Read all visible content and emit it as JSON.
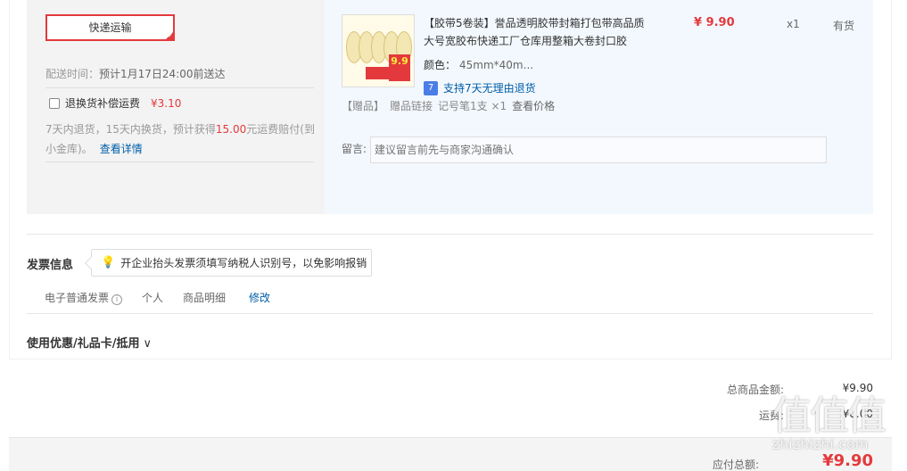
{
  "shipping": {
    "method": "快递运输",
    "delivery_label": "配送时间：",
    "delivery_value": "预计1月17日24:00前送达",
    "freight_insurance_label": "退换货补偿运费",
    "freight_insurance_price": "¥3.10",
    "policy_pre": "7天内退货，15天内换货，预计获得",
    "policy_amount": "15.00",
    "policy_post": "元运费赔付(到小金库)。",
    "policy_link": "查看详情"
  },
  "goods": {
    "title": "【胶带5卷装】誉品透明胶带封箱打包带高品质大号宽胶布快递工厂仓库用整箱大卷封口胶",
    "attr_key": "颜色：",
    "attr_value": "45mm*40m...",
    "return_label": "支持7天无理由退货",
    "gift_tag": "【赠品】",
    "gift_link": "赠品链接",
    "gift_item": "记号笔1支 ×1",
    "gift_price_link": "查看价格",
    "price": "¥ 9.90",
    "qty": "x1",
    "stock": "有货",
    "thumb_badge": "9.9"
  },
  "memo": {
    "label": "留言:",
    "placeholder": "建议留言前先与商家沟通确认"
  },
  "invoice": {
    "title": "发票信息",
    "tip": "开企业抬头发票须填写纳税人识别号，以免影响报销",
    "type": "电子普通发票",
    "info_icon": "i",
    "holder": "个人",
    "content": "商品明细",
    "edit": "修改"
  },
  "coupon": {
    "label": "使用优惠/礼品卡/抵用",
    "chevron": "∨"
  },
  "summary": {
    "goods_total_label": "总商品金额:",
    "goods_total_value": "¥9.90",
    "shipping_label": "运费:",
    "shipping_value": "¥0.00",
    "payable_label": "应付总额:",
    "payable_value": "¥9.90"
  },
  "watermark": {
    "glyphs": "值值值",
    "url": "zhizhizhi.com"
  },
  "colors": {
    "accent": "#e4393c",
    "link": "#005ea7",
    "goods_bg": "#f3f8fe",
    "shipping_bg": "#f3f3f3"
  }
}
